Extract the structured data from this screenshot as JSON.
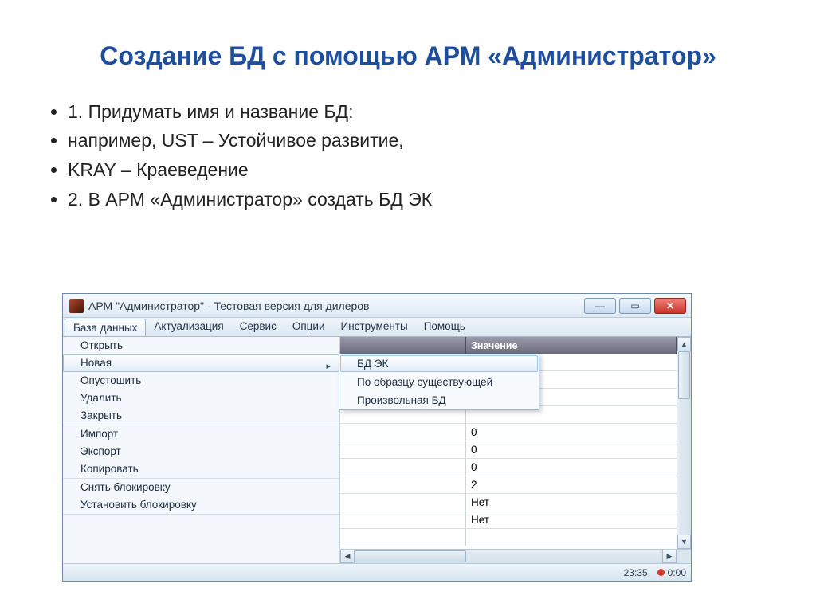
{
  "slide": {
    "title": "Создание БД с помощью АРМ «Администратор»",
    "bullets": [
      "1. Придумать имя и название БД:",
      "например, UST – Устойчивое развитие,",
      "KRAY – Краеведение",
      "2. В АРМ «Администратор» создать БД ЭК"
    ]
  },
  "window": {
    "title": "АРМ \"Администратор\" - Тестовая версия для дилеров",
    "menubar": [
      "База данных",
      "Актуализация",
      "Сервис",
      "Опции",
      "Инструменты",
      "Помощь"
    ],
    "menu_groups": [
      [
        "Открыть",
        "Новая",
        "Опустошить",
        "Удалить",
        "Закрыть"
      ],
      [
        "Импорт",
        "Экспорт",
        "Копировать"
      ],
      [
        "Снять блокировку",
        "Установить блокировку"
      ]
    ],
    "menu_highlight": "Новая",
    "submenu": [
      "БД ЭК",
      "По образцу существующей",
      "Произвольная БД"
    ],
    "submenu_highlight": "БД ЭК",
    "grid_header_value": "Значение",
    "grid_values": [
      "0",
      "0",
      "0",
      "2",
      "Нет",
      "Нет"
    ],
    "status": {
      "time": "23:35",
      "rec": "0:00"
    }
  }
}
